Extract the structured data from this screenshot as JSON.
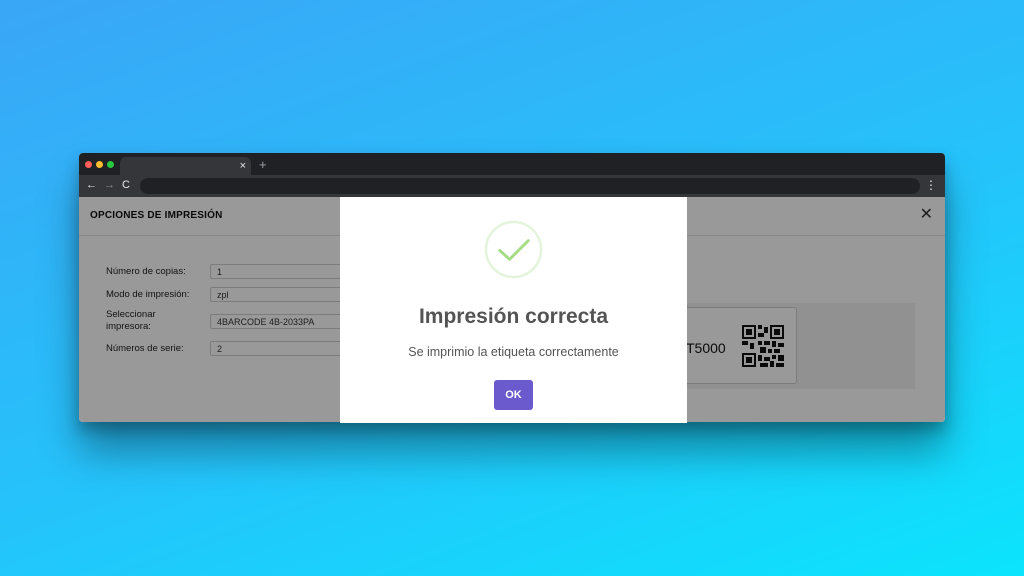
{
  "browser": {
    "tab_close": "×",
    "new_tab": "+",
    "back": "←",
    "forward": "→",
    "reload": "C",
    "menu": "⋮"
  },
  "panel": {
    "title": "OPCIONES DE IMPRESIÓN",
    "close": "✕",
    "fields": [
      {
        "label": "Número de copias:",
        "value": "1"
      },
      {
        "label": "Modo de impresión:",
        "value": "zpl"
      },
      {
        "label": "Seleccionar impresora:",
        "value": "4BARCODE 4B-2033PA"
      },
      {
        "label": "Números de serie:",
        "value": "2"
      }
    ],
    "preview": {
      "label_text": "T5000"
    }
  },
  "modal": {
    "title": "Impresión correcta",
    "message": "Se imprimio la etiqueta correctamente",
    "ok_label": "OK",
    "accent": "#6a5acd",
    "success_color": "#a5dc86"
  }
}
